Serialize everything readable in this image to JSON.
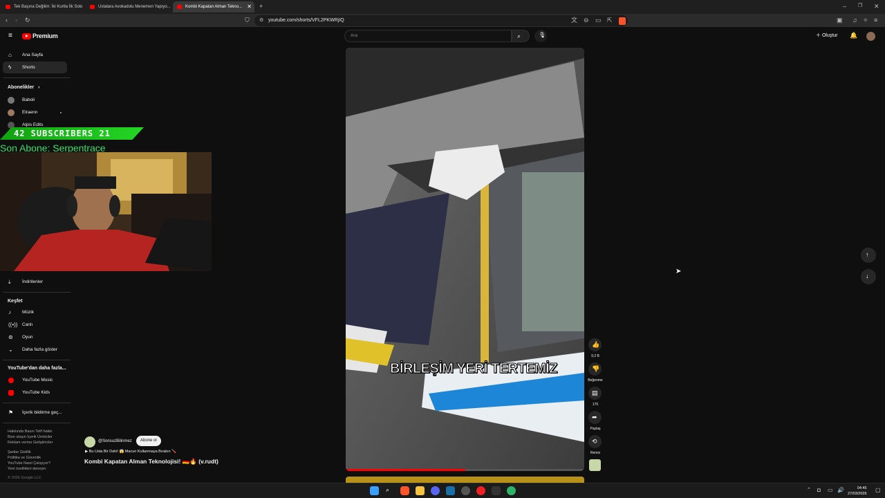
{
  "browser": {
    "tabs": [
      {
        "label": "Tek Başına Değilim: İki Kurtla İlk Solo"
      },
      {
        "label": "Ustalara Avokadolu Menemen Yapıyo..."
      },
      {
        "label": "Kombi Kapatan Alman Tekno..."
      }
    ],
    "new_tab": "+",
    "url": "youtube.com/shorts/VFL2PKWRjIQ",
    "window_controls": [
      "–",
      "❐",
      "✕"
    ]
  },
  "youtube": {
    "logo": "Premium",
    "search_placeholder": "Ara",
    "create_label": "Oluştur",
    "sidebar": {
      "main": [
        {
          "label": "Ana Sayfa",
          "icon": "home-icon"
        },
        {
          "label": "Shorts",
          "icon": "shorts-icon"
        }
      ],
      "subs_title": "Abonelikler",
      "subs": [
        {
          "label": "Baboli"
        },
        {
          "label": "Elraenn"
        },
        {
          "label": "Alpis Edits"
        }
      ],
      "downloads": "İndirilenler",
      "explore_title": "Keşfet",
      "explore": [
        {
          "label": "Müzik",
          "icon": "music-icon"
        },
        {
          "label": "Canlı",
          "icon": "live-icon"
        },
        {
          "label": "Oyun",
          "icon": "gaming-icon"
        },
        {
          "label": "Daha fazla göster",
          "icon": "chevron-down-icon"
        }
      ],
      "more_title": "YouTube'dan daha fazla...",
      "more": [
        {
          "label": "YouTube Music"
        },
        {
          "label": "YouTube Kids"
        }
      ],
      "report": "İçerik bildirme geç...",
      "footer": [
        "Hakkında  Basın  Telif hakkı",
        "Bize ulaşın  İçerik Üreticiler",
        "Reklam verme  Geliştiriciler",
        "",
        "Şartlar  Gizlilik",
        "Politika ve Güvenlik",
        "YouTube Nasıl Çalışıyor?",
        "Yeni özellikleri deneyin"
      ],
      "copyright": "© 2026 Google LLC"
    },
    "short": {
      "caption": "BİRLEŞİM YERİ TERTEMİZ",
      "channel": "@SonsuzBilinmez",
      "subscribe": "Abone ol",
      "sound": "Bu Usta Bir Dahi! 😱 Macun Kullanmaya Bırakın 🪛",
      "title": "Kombi Kapatan Alman Teknolojisi! 🇩🇪🔥 (v.rudt)",
      "likes": "9,2 B",
      "dislike_label": "Beğenme",
      "comments": "170",
      "share_label": "Paylaş",
      "remix_label": "Remix",
      "progress": 0.5
    }
  },
  "stream_overlay": {
    "subscribers_text": "42  SUBSCRIBERS  21",
    "last_sub": "Son Abone: Serpentrace"
  },
  "taskbar": {
    "time": "04:45",
    "date": "27/03/2026"
  }
}
